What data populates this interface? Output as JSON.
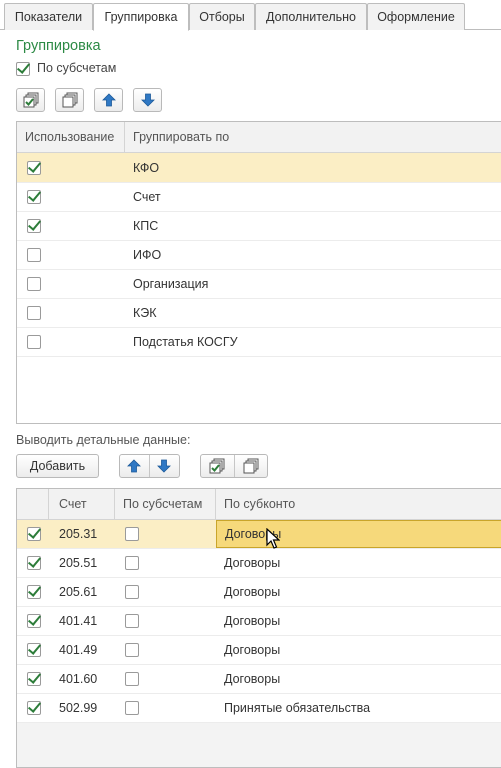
{
  "tabs": [
    {
      "label": "Показатели"
    },
    {
      "label": "Группировка"
    },
    {
      "label": "Отборы"
    },
    {
      "label": "Дополнительно"
    },
    {
      "label": "Оформление"
    }
  ],
  "active_tab": "Группировка",
  "grouping": {
    "title": "Группировка",
    "by_subaccounts": {
      "label": "По субсчетам",
      "checked": true
    },
    "table": {
      "headers": {
        "usage": "Использование",
        "group_by": "Группировать по"
      },
      "rows": [
        {
          "checked": true,
          "name": "КФО"
        },
        {
          "checked": true,
          "name": "Счет"
        },
        {
          "checked": true,
          "name": "КПС"
        },
        {
          "checked": false,
          "name": "ИФО"
        },
        {
          "checked": false,
          "name": "Организация"
        },
        {
          "checked": false,
          "name": "КЭК"
        },
        {
          "checked": false,
          "name": "Подстатья КОСГУ"
        }
      ]
    }
  },
  "details": {
    "label": "Выводить детальные данные:",
    "add_button": "Добавить",
    "table": {
      "headers": {
        "account": "Счет",
        "by_subaccounts": "По субсчетам",
        "by_subconto": "По субконто"
      },
      "rows": [
        {
          "checked": true,
          "account": "205.31",
          "by_subaccounts": false,
          "subconto": "Договоры"
        },
        {
          "checked": true,
          "account": "205.51",
          "by_subaccounts": false,
          "subconto": "Договоры"
        },
        {
          "checked": true,
          "account": "205.61",
          "by_subaccounts": false,
          "subconto": "Договоры"
        },
        {
          "checked": true,
          "account": "401.41",
          "by_subaccounts": false,
          "subconto": "Договоры"
        },
        {
          "checked": true,
          "account": "401.49",
          "by_subaccounts": false,
          "subconto": "Договоры"
        },
        {
          "checked": true,
          "account": "401.60",
          "by_subaccounts": false,
          "subconto": "Договоры"
        },
        {
          "checked": true,
          "account": "502.99",
          "by_subaccounts": false,
          "subconto": "Принятые обязательства"
        }
      ]
    }
  },
  "icons": {
    "check_all": "check-all-icon",
    "uncheck_all": "uncheck-all-icon",
    "move_up": "arrow-up-icon",
    "move_down": "arrow-down-icon"
  },
  "colors": {
    "title_green": "#2c8a45",
    "selection": "#fbeec5",
    "focus_cell": "#f6d97b",
    "arrow_blue": "#2f78c4"
  }
}
